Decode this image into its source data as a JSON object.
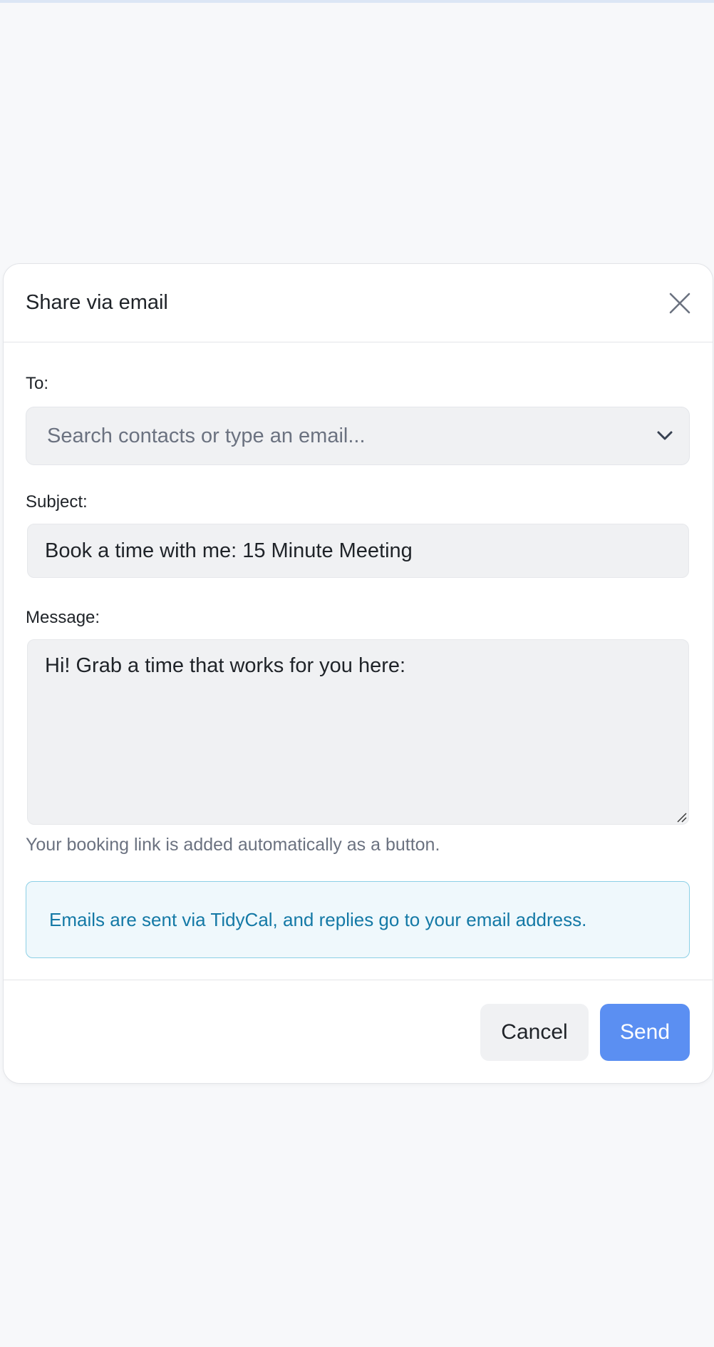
{
  "modal": {
    "title": "Share via email",
    "to": {
      "label": "To:",
      "placeholder": "Search contacts or type an email..."
    },
    "subject": {
      "label": "Subject:",
      "value": "Book a time with me: 15 Minute Meeting"
    },
    "message": {
      "label": "Message:",
      "value": "Hi! Grab a time that works for you here:",
      "helper": "Your booking link is added automatically as a button."
    },
    "info": "Emails are sent via TidyCal, and replies go to your email address.",
    "buttons": {
      "cancel": "Cancel",
      "send": "Send"
    }
  },
  "icons": {
    "close": "close-icon",
    "dropdown": "chevron-down-icon",
    "resize": "resize-handle-icon"
  },
  "colors": {
    "accent": "#5b8ff2",
    "info_text": "#1479a6",
    "info_bg": "#eff8fc",
    "info_border": "#8cd0e6"
  }
}
